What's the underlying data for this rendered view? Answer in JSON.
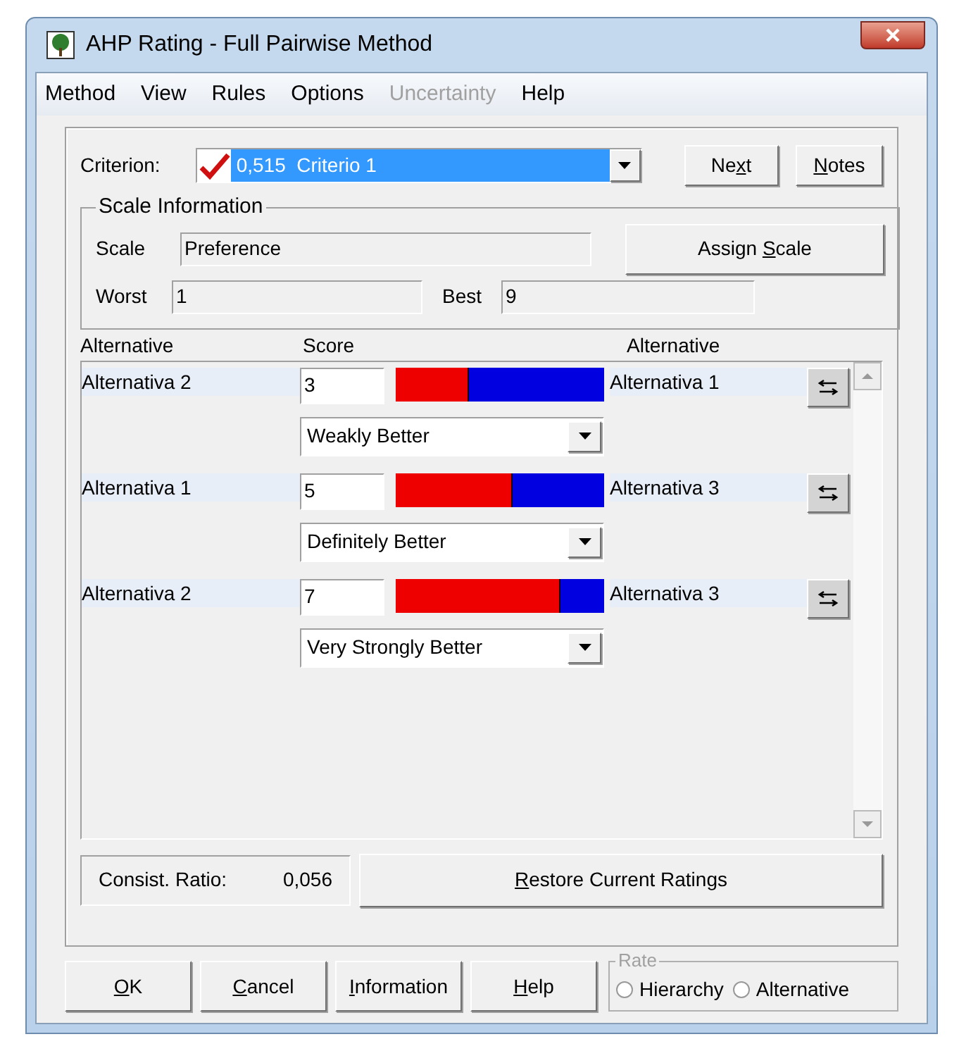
{
  "window": {
    "title": "AHP Rating - Full Pairwise Method"
  },
  "menu": [
    {
      "label": "Method",
      "disabled": false
    },
    {
      "label": "View",
      "disabled": false
    },
    {
      "label": "Rules",
      "disabled": false
    },
    {
      "label": "Options",
      "disabled": false
    },
    {
      "label": "Uncertainty",
      "disabled": true
    },
    {
      "label": "Help",
      "disabled": false
    }
  ],
  "criterion": {
    "label": "Criterion:",
    "value": "0,515  Criterio 1",
    "checked": true
  },
  "top_buttons": [
    {
      "before": "Ne",
      "key": "x",
      "after": "t"
    },
    {
      "key": "N",
      "after": "otes"
    }
  ],
  "scale_info": {
    "title": "Scale Information",
    "scale_label": "Scale",
    "scale_value": "Preference",
    "worst_label": "Worst",
    "worst_value": "1",
    "best_label": "Best",
    "best_value": "9",
    "assign_button": {
      "before": "Assign ",
      "key": "S",
      "after": "cale"
    }
  },
  "columns": [
    "Alternative",
    "Score",
    "Alternative"
  ],
  "comparisons": [
    {
      "left": "Alternativa 2",
      "score": "3",
      "level": 0.35,
      "verbal": "Weakly Better",
      "right": "Alternativa 1"
    },
    {
      "left": "Alternativa 1",
      "score": "5",
      "level": 0.56,
      "verbal": "Definitely Better",
      "right": "Alternativa 3"
    },
    {
      "left": "Alternativa 2",
      "score": "7",
      "level": 0.79,
      "verbal": "Very Strongly Better",
      "right": "Alternativa 3"
    }
  ],
  "consistency": {
    "label": "Consist. Ratio:",
    "value": "0,056"
  },
  "restore_button": {
    "key": "R",
    "after": "estore Current Ratings"
  },
  "bottom_buttons": [
    {
      "key": "O",
      "after": "K"
    },
    {
      "key": "C",
      "after": "ancel"
    },
    {
      "key": "I",
      "after": "nformation"
    },
    {
      "key": "H",
      "after": "elp"
    }
  ],
  "rate": {
    "title": "Rate",
    "disabled": true,
    "options": [
      {
        "label": "Hierarchy",
        "selected": false
      },
      {
        "label": "Alternative",
        "selected": false
      }
    ]
  }
}
